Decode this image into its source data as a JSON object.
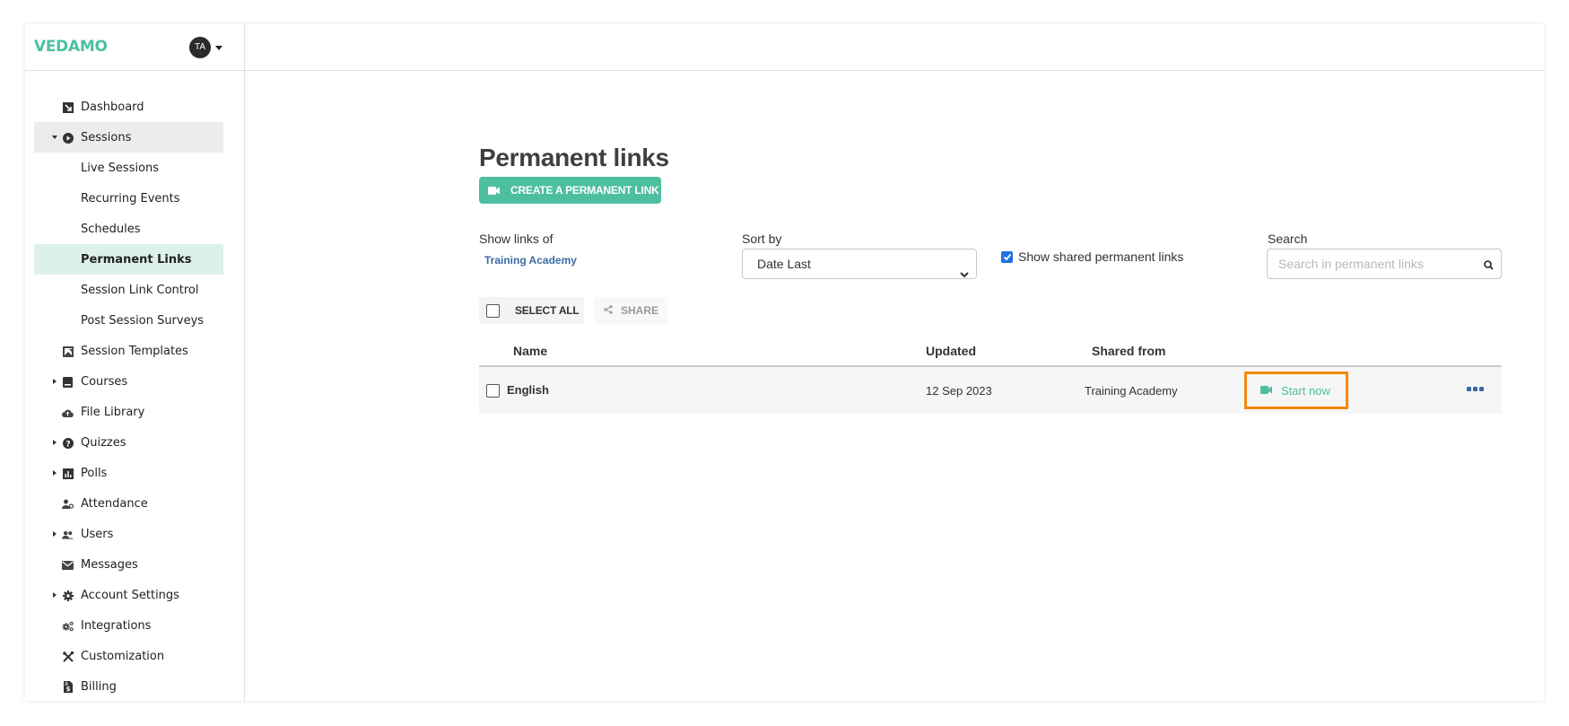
{
  "app": {
    "logo": "VEDAMO",
    "user_initials": "TA"
  },
  "sidebar": {
    "items": [
      {
        "label": "Dashboard",
        "icon": "dashboard-icon",
        "caret": null,
        "level": 0,
        "state": ""
      },
      {
        "label": "Sessions",
        "icon": "play-circle-icon",
        "caret": "down",
        "level": 0,
        "state": "active-parent"
      },
      {
        "label": "Live Sessions",
        "icon": null,
        "caret": null,
        "level": 1,
        "state": ""
      },
      {
        "label": "Recurring Events",
        "icon": null,
        "caret": null,
        "level": 1,
        "state": ""
      },
      {
        "label": "Schedules",
        "icon": null,
        "caret": null,
        "level": 1,
        "state": ""
      },
      {
        "label": "Permanent Links",
        "icon": null,
        "caret": null,
        "level": 1,
        "state": "active"
      },
      {
        "label": "Session Link Control",
        "icon": null,
        "caret": null,
        "level": 1,
        "state": ""
      },
      {
        "label": "Post Session Surveys",
        "icon": null,
        "caret": null,
        "level": 1,
        "state": ""
      },
      {
        "label": "Session Templates",
        "icon": "template-icon",
        "caret": null,
        "level": 0,
        "state": ""
      },
      {
        "label": "Courses",
        "icon": "book-icon",
        "caret": "right",
        "level": 0,
        "state": ""
      },
      {
        "label": "File Library",
        "icon": "cloud-upload-icon",
        "caret": null,
        "level": 0,
        "state": ""
      },
      {
        "label": "Quizzes",
        "icon": "question-circle-icon",
        "caret": "right",
        "level": 0,
        "state": ""
      },
      {
        "label": "Polls",
        "icon": "poll-chart-icon",
        "caret": "right",
        "level": 0,
        "state": ""
      },
      {
        "label": "Attendance",
        "icon": "attendance-icon",
        "caret": null,
        "level": 0,
        "state": ""
      },
      {
        "label": "Users",
        "icon": "users-icon",
        "caret": "right",
        "level": 0,
        "state": ""
      },
      {
        "label": "Messages",
        "icon": "envelope-icon",
        "caret": null,
        "level": 0,
        "state": ""
      },
      {
        "label": "Account Settings",
        "icon": "gear-icon",
        "caret": "right",
        "level": 0,
        "state": ""
      },
      {
        "label": "Integrations",
        "icon": "gears-icon",
        "caret": null,
        "level": 0,
        "state": ""
      },
      {
        "label": "Customization",
        "icon": "tools-icon",
        "caret": null,
        "level": 0,
        "state": ""
      },
      {
        "label": "Billing",
        "icon": "invoice-icon",
        "caret": null,
        "level": 0,
        "state": ""
      }
    ]
  },
  "main": {
    "title": "Permanent links",
    "create_button": "CREATE A PERMANENT LINK",
    "filters": {
      "show_links_label": "Show links of",
      "show_links_value": "Training Academy",
      "sort_label": "Sort by",
      "sort_value": "Date Last",
      "shared_checkbox_label": "Show shared permanent links",
      "shared_checked": true,
      "search_label": "Search",
      "search_placeholder": "Search in permanent links",
      "search_value": ""
    },
    "bulk": {
      "select_all": "SELECT ALL",
      "share": "SHARE"
    },
    "table": {
      "headers": {
        "name": "Name",
        "updated": "Updated",
        "shared_from": "Shared from"
      },
      "rows": [
        {
          "name": "English",
          "updated": "12 Sep 2023",
          "shared_from": "Training Academy",
          "action": "Start now"
        }
      ]
    }
  },
  "colors": {
    "brand": "#4dbfa0",
    "link": "#3a6aa6",
    "highlight_border": "#f7870f",
    "active_nav": "#dcf1ea"
  }
}
